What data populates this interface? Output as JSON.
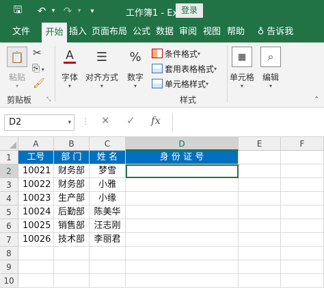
{
  "titlebar": {
    "title": "工作簿1 - Ex...",
    "login_label": "登录",
    "save_glyph": "🖫",
    "undo_glyph": "↶",
    "redo_glyph": "↷",
    "customize_glyph": "▾"
  },
  "tabs": [
    {
      "label": "文件"
    },
    {
      "label": "开始"
    },
    {
      "label": "插入"
    },
    {
      "label": "页面布局"
    },
    {
      "label": "公式"
    },
    {
      "label": "数据"
    },
    {
      "label": "审阅"
    },
    {
      "label": "视图"
    },
    {
      "label": "帮助"
    },
    {
      "label": "告诉我"
    }
  ],
  "ribbon": {
    "clipboard": {
      "paste_label": "粘贴",
      "group_label": "剪贴板"
    },
    "font": {
      "label": "字体"
    },
    "alignment": {
      "label": "对齐方式"
    },
    "number": {
      "label": "数字",
      "glyph": "%"
    },
    "styles": {
      "conditional_format": "条件格式",
      "table_format": "套用表格格式",
      "cell_style": "单元格样式",
      "group_label": "样式"
    },
    "cells": {
      "label": "单元格"
    },
    "editing": {
      "label": "编辑"
    }
  },
  "formula_bar": {
    "name_box": "D2",
    "fx": "fx",
    "value": ""
  },
  "sheet": {
    "columns": [
      "A",
      "B",
      "C",
      "D",
      "E",
      "F"
    ],
    "rows": [
      "1",
      "2",
      "3",
      "4",
      "5",
      "6",
      "7",
      "8",
      "9",
      "10"
    ],
    "selected_column": "D",
    "selected_row": "2",
    "header": [
      "工号",
      "部 门",
      "姓 名",
      "身 份 证 号"
    ],
    "data": [
      [
        "10021",
        "财务部",
        "梦雪"
      ],
      [
        "10022",
        "财务部",
        "小雅"
      ],
      [
        "10023",
        "生产部",
        "小缘"
      ],
      [
        "10024",
        "后勤部",
        "陈美华"
      ],
      [
        "10025",
        "销售部",
        "汪志刚"
      ],
      [
        "10026",
        "技术部",
        "李丽君"
      ]
    ]
  },
  "colors": {
    "brand": "#217346",
    "header_fill": "#0070c0"
  }
}
